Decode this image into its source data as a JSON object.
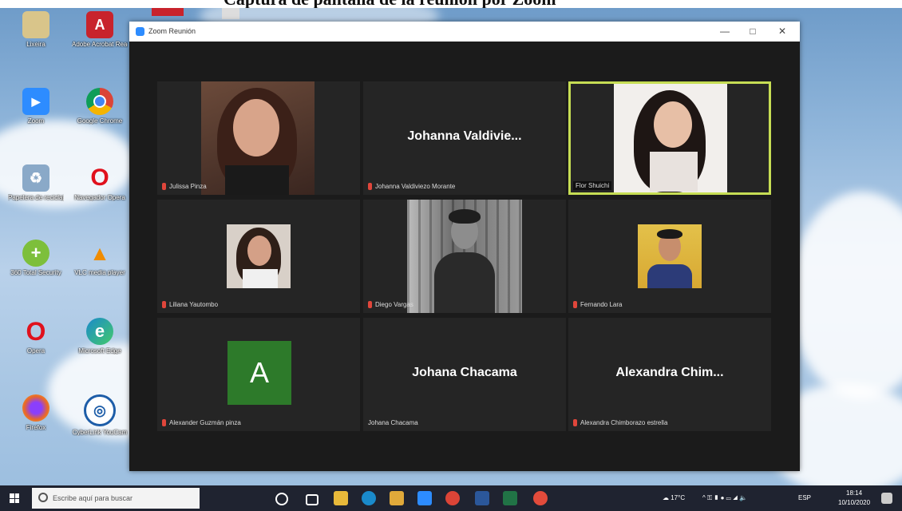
{
  "page": {
    "cropped_heading": "Captura de pantalla de la reunión por Zoom"
  },
  "desktop": {
    "icons": [
      {
        "name": "recycle-bin",
        "label": "Lixeira",
        "color": "#d9c58a",
        "glyph": ""
      },
      {
        "name": "adobe-reader",
        "label": "Adobe Acrobat Reader",
        "color": "#c8232c",
        "glyph": "A"
      },
      {
        "name": "zoom",
        "label": "Zoom",
        "color": "#2d8cff",
        "glyph": "▶"
      },
      {
        "name": "chrome",
        "label": "Google Chrome",
        "color": "#3aa757",
        "glyph": "●"
      },
      {
        "name": "papelera",
        "label": "Papelera de reciclaje",
        "color": "#8aa9c8",
        "glyph": "♻"
      },
      {
        "name": "opera-gx",
        "label": "Navegador Opera",
        "color": "#d0021b",
        "glyph": "O"
      },
      {
        "name": "security",
        "label": "360 Total Security",
        "color": "#7dbf3b",
        "glyph": "+"
      },
      {
        "name": "vlc",
        "label": "VLC media player",
        "color": "#f08c00",
        "glyph": "▲"
      },
      {
        "name": "opera",
        "label": "Opera",
        "color": "#e0111d",
        "glyph": "O"
      },
      {
        "name": "edge",
        "label": "Microsoft Edge",
        "color": "#1a8acb",
        "glyph": "e"
      },
      {
        "name": "firefox",
        "label": "Firefox",
        "color": "#e8672a",
        "glyph": "◉"
      },
      {
        "name": "cyberlink",
        "label": "CyberLink YouCam",
        "color": "#1d5da8",
        "glyph": "◎"
      }
    ]
  },
  "zoom": {
    "title": "Zoom Reunión",
    "minimize": "—",
    "maximize": "□",
    "close": "✕",
    "tiles": [
      {
        "big": "",
        "caption": "Julissa Pinza",
        "mic_muted": true,
        "photo": "p1"
      },
      {
        "big": "Johanna  Valdivie...",
        "caption": "Johanna Valdiviezo Morante",
        "mic_muted": true,
        "photo": ""
      },
      {
        "big": "",
        "caption": "Flor Shuichi",
        "mic_muted": false,
        "photo": "p3",
        "active": true
      },
      {
        "big": "",
        "caption": "Liliana Yautombo",
        "mic_muted": true,
        "photo": "p4"
      },
      {
        "big": "",
        "caption": "Diego Vargas",
        "mic_muted": true,
        "photo": "p5"
      },
      {
        "big": "",
        "caption": "Fernando Lara",
        "mic_muted": true,
        "photo": "p6"
      },
      {
        "big": "",
        "caption": "Alexander  Guzmán pinza",
        "mic_muted": true,
        "photo": "avatarA",
        "avatar_letter": "A"
      },
      {
        "big": "Johana Chacama",
        "caption": "Johana Chacama",
        "mic_muted": false,
        "photo": ""
      },
      {
        "big": "Alexandra  Chim...",
        "caption": "Alexandra Chimborazo estrella",
        "mic_muted": true,
        "photo": ""
      }
    ]
  },
  "taskbar": {
    "search_placeholder": "Escribe aquí para buscar",
    "weather": "17°C",
    "lang": "ESP",
    "time": "18:14",
    "date": "10/10/2020"
  }
}
